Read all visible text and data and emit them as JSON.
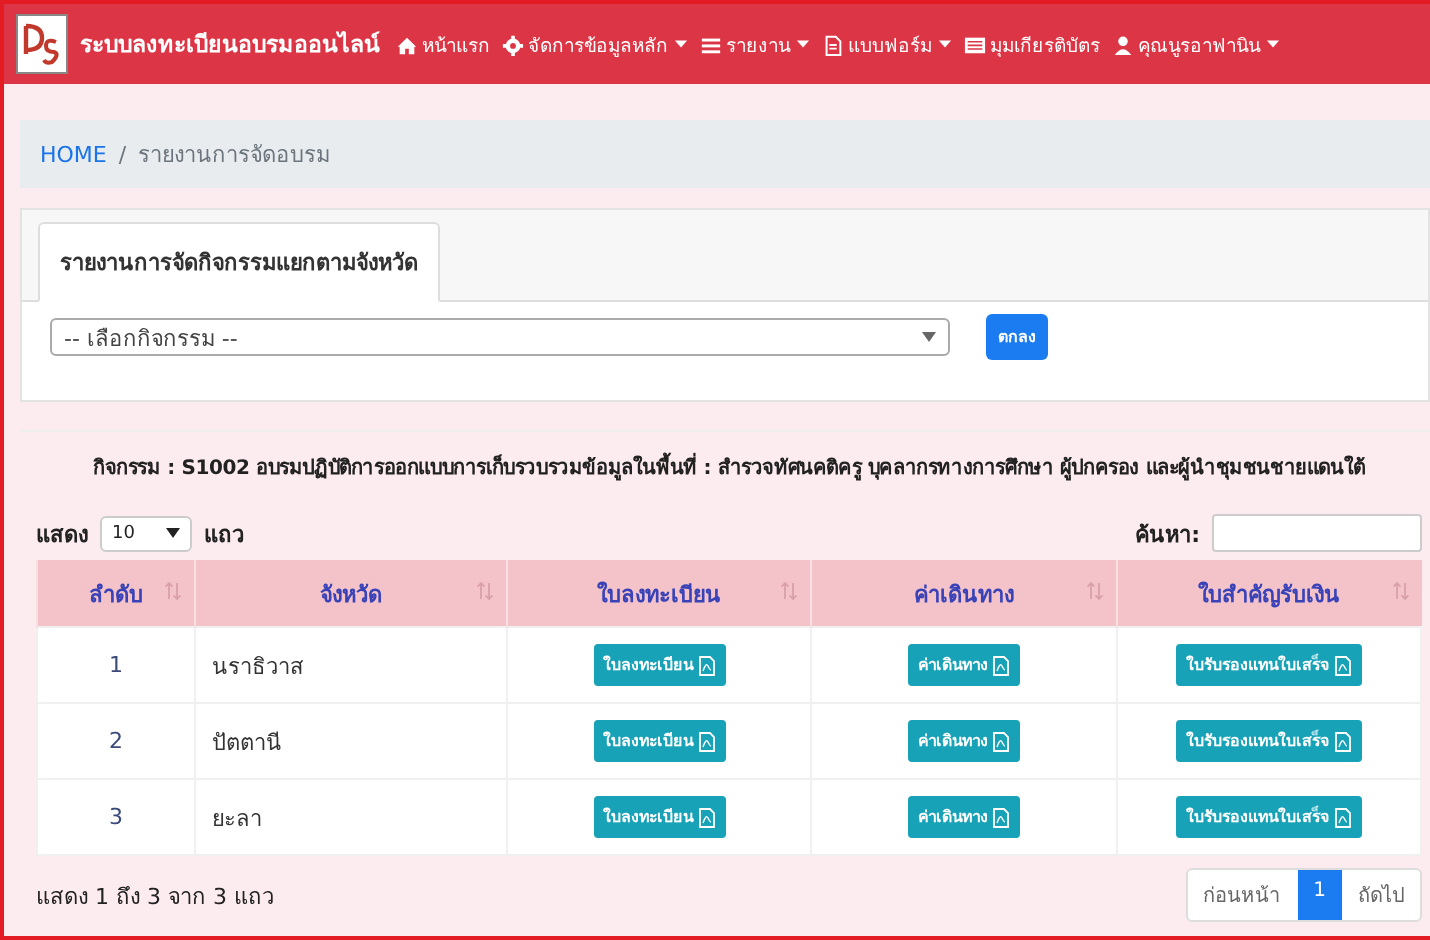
{
  "navbar": {
    "brand": "ระบบลงทะเบียนอบรมออนไลน์",
    "items": [
      {
        "label": "หน้าแรก",
        "dropdown": false
      },
      {
        "label": "จัดการข้อมูลหลัก",
        "dropdown": true
      },
      {
        "label": "รายงาน",
        "dropdown": true
      },
      {
        "label": "แบบฟอร์ม",
        "dropdown": true
      },
      {
        "label": "มุมเกียรติบัตร",
        "dropdown": false
      },
      {
        "label": "คุณนูรอาฟานิน",
        "dropdown": true
      }
    ]
  },
  "breadcrumb": [
    {
      "label": "HOME",
      "kind": "link"
    },
    {
      "label": "/",
      "kind": "separator"
    },
    {
      "label": "รายงานการจัดอบรม",
      "kind": "current"
    }
  ],
  "tabs": [
    {
      "label": "รายงานการจัดกิจกรรมแยกตามจังหวัด",
      "selected": true
    }
  ],
  "activity_select": {
    "placeholder": "-- เลือกกิจกรรม --"
  },
  "submit_button": "ตกลง",
  "activity_title": "กิจกรรม : S1002 อบรมปฏิบัติการออกแบบการเก็บรวบรวมข้อมูลในพื้นที่ : สำรวจทัศนคติครู บุคลากรทางการศึกษา ผู้ปกครอง และผู้นำชุมชนชายแดนใต้",
  "length": {
    "before": "แสดง",
    "value": "10",
    "after": "แถว"
  },
  "search": {
    "label": "ค้นหา:"
  },
  "table": {
    "columns": [
      "ลำดับ",
      "จังหวัด",
      "ใบลงทะเบียน",
      "ค่าเดินทาง",
      "ใบสำคัญรับเงิน"
    ],
    "rows": [
      {
        "no": "1",
        "province": "นราธิวาส",
        "buttons": [
          "ใบลงทะเบียน",
          "ค่าเดินทาง",
          "ใบรับรองแทนใบเสร็จ"
        ]
      },
      {
        "no": "2",
        "province": "ปัตตานี",
        "buttons": [
          "ใบลงทะเบียน",
          "ค่าเดินทาง",
          "ใบรับรองแทนใบเสร็จ"
        ]
      },
      {
        "no": "3",
        "province": "ยะลา",
        "buttons": [
          "ใบลงทะเบียน",
          "ค่าเดินทาง",
          "ใบรับรองแทนใบเสร็จ"
        ]
      }
    ]
  },
  "info": "แสดง 1 ถึง 3 จาก 3 แถว",
  "pagination": [
    {
      "label": "ก่อนหน้า",
      "selected": false
    },
    {
      "label": "1",
      "selected": true
    },
    {
      "label": "ถัดไป",
      "selected": false
    }
  ]
}
